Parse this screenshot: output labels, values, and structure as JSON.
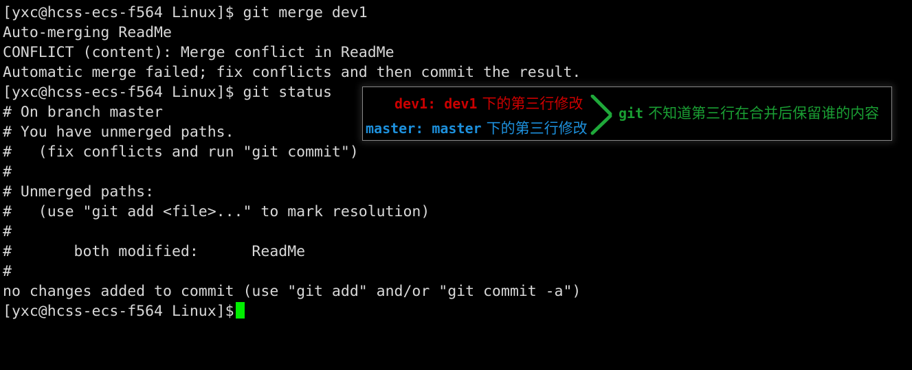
{
  "terminal": {
    "background_color": "#000000",
    "foreground_color": "#d8d8d8",
    "cursor_color": "#00ee00",
    "lines": [
      "[yxc@hcss-ecs-f564 Linux]$ git merge dev1",
      "Auto-merging ReadMe",
      "CONFLICT (content): Merge conflict in ReadMe",
      "Automatic merge failed; fix conflicts and then commit the result.",
      "[yxc@hcss-ecs-f564 Linux]$ git status",
      "# On branch master",
      "# You have unmerged paths.",
      "#   (fix conflicts and run \"git commit\")",
      "#",
      "# Unmerged paths:",
      "#   (use \"git add <file>...\" to mark resolution)",
      "#",
      "#       both modified:      ReadMe",
      "#",
      "no changes added to commit (use \"git add\" and/or \"git commit -a\")"
    ],
    "prompt": "[yxc@hcss-ecs-f564 Linux]$",
    "cursor": "block-cursor"
  },
  "annotation": {
    "dev1_label": "dev1:",
    "dev1_value": "dev1",
    "dev1_cjk": "下的第三行修改",
    "dev1_color": "#cc0000",
    "master_label": "master:",
    "master_value": "master",
    "master_cjk": "下的第三行修改",
    "master_color": "#1d90dc",
    "git_label": "git",
    "git_cjk": "不知道第三行在合并后保留谁的内容",
    "git_color": "#1a9e33",
    "brace_color": "#1fa83a"
  }
}
